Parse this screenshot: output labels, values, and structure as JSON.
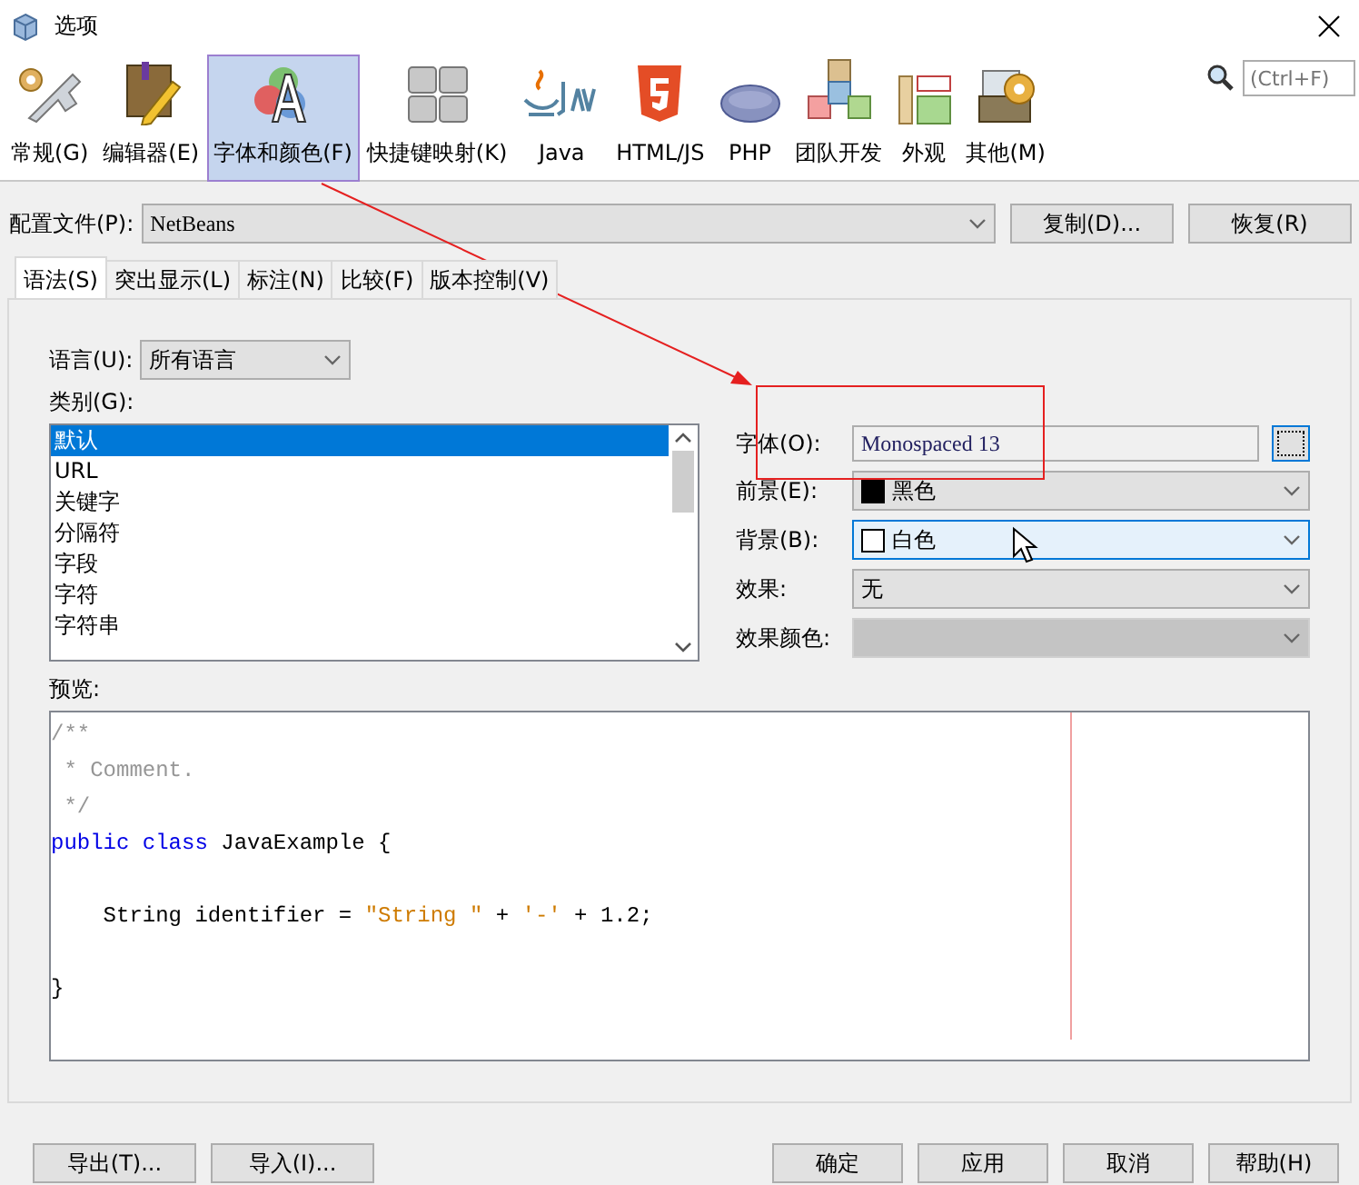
{
  "window": {
    "title": "选项"
  },
  "toolbar": {
    "items": [
      {
        "label": "常规(G)",
        "selected": false
      },
      {
        "label": "编辑器(E)",
        "selected": false
      },
      {
        "label": "字体和颜色(F)",
        "selected": true
      },
      {
        "label": "快捷键映射(K)",
        "selected": false
      },
      {
        "label": "Java",
        "selected": false
      },
      {
        "label": "HTML/JS",
        "selected": false
      },
      {
        "label": "PHP",
        "selected": false
      },
      {
        "label": "团队开发",
        "selected": false
      },
      {
        "label": "外观",
        "selected": false
      },
      {
        "label": "其他(M)",
        "selected": false
      }
    ],
    "search": {
      "placeholder": "(Ctrl+F)"
    }
  },
  "profile": {
    "label": "配置文件(P):",
    "value": "NetBeans",
    "buttons": [
      "复制(D)...",
      "恢复(R)"
    ]
  },
  "tabs": [
    {
      "label": "语法(S)",
      "selected": true
    },
    {
      "label": "突出显示(L)",
      "selected": false
    },
    {
      "label": "标注(N)",
      "selected": false
    },
    {
      "label": "比较(F)",
      "selected": false
    },
    {
      "label": "版本控制(V)",
      "selected": false
    }
  ],
  "language": {
    "label": "语言(U):",
    "value": "所有语言"
  },
  "category": {
    "label": "类别(G):",
    "items": [
      {
        "text": "默认",
        "selected": true
      },
      {
        "text": "URL",
        "selected": false
      },
      {
        "text": "关键字",
        "selected": false
      },
      {
        "text": "分隔符",
        "selected": false
      },
      {
        "text": "字段",
        "selected": false
      },
      {
        "text": "字符",
        "selected": false
      },
      {
        "text": "字符串",
        "selected": false
      }
    ]
  },
  "properties": [
    {
      "kind": "text",
      "label": "字体(O):",
      "value": "Monospaced 13",
      "hovered": false,
      "disabled": false
    },
    {
      "kind": "color",
      "label": "前景(E):",
      "value": "黑色",
      "color": "#000000",
      "hovered": false,
      "disabled": false
    },
    {
      "kind": "color",
      "label": "背景(B):",
      "value": "白色",
      "color": "#ffffff",
      "hovered": true,
      "disabled": false
    },
    {
      "kind": "select",
      "label": "效果:",
      "value": "无",
      "hovered": false,
      "disabled": false
    },
    {
      "kind": "select",
      "label": "效果颜色:",
      "hovered": false,
      "disabled": true
    }
  ],
  "preview": {
    "label": "预览:",
    "lines": [
      {
        "kind": "code",
        "tokens": [
          {
            "kind": "comment",
            "text": "/**"
          }
        ]
      },
      {
        "kind": "code",
        "tokens": [
          {
            "kind": "comment",
            "text": " * Comment."
          }
        ]
      },
      {
        "kind": "code",
        "tokens": [
          {
            "kind": "comment",
            "text": " */"
          }
        ]
      },
      {
        "kind": "code",
        "tokens": [
          {
            "kind": "keyword",
            "text": "public class"
          },
          {
            "kind": "plain",
            "text": " JavaExample {"
          }
        ]
      },
      {
        "kind": "blank"
      },
      {
        "kind": "code",
        "tokens": [
          {
            "kind": "plain",
            "text": "    String identifier = "
          },
          {
            "kind": "string",
            "text": "\"String \""
          },
          {
            "kind": "plain",
            "text": " + "
          },
          {
            "kind": "string",
            "text": "'-'"
          },
          {
            "kind": "plain",
            "text": " + 1.2;"
          }
        ]
      },
      {
        "kind": "blank"
      },
      {
        "kind": "code",
        "tokens": [
          {
            "kind": "plain",
            "text": "}"
          }
        ]
      }
    ]
  },
  "footer": {
    "left": [
      "导出(T)...",
      "导入(I)..."
    ],
    "right": [
      "确定",
      "应用",
      "取消",
      "帮助(H)"
    ]
  }
}
